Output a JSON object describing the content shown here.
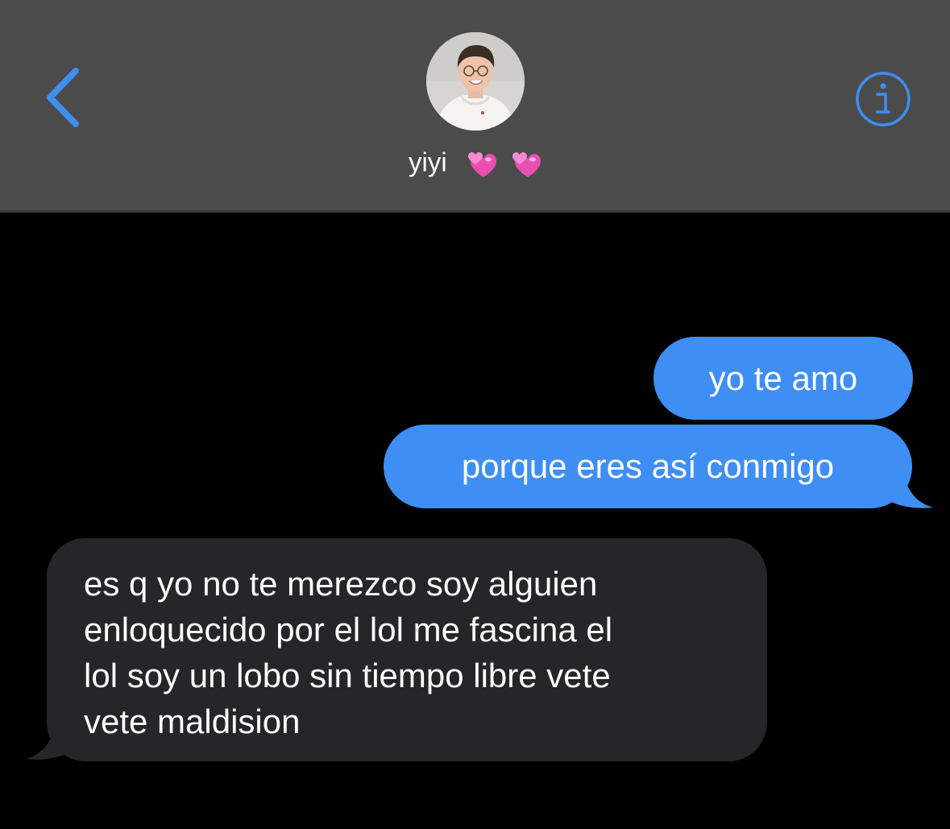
{
  "header": {
    "contact_name": "yiyi",
    "contact_emoji": [
      "revolving-hearts-icon",
      "revolving-hearts-icon"
    ],
    "back_icon": "chevron-left-icon",
    "info_icon": "info-icon",
    "accent_color": "#3e8ef4",
    "background_color": "#4b4b4b"
  },
  "messages": [
    {
      "direction": "outgoing",
      "text": "yo te amo"
    },
    {
      "direction": "outgoing",
      "text": "porque eres así conmigo"
    },
    {
      "direction": "incoming",
      "lines": [
        "es q yo no te merezco soy alguien",
        "enloquecido por el lol me fascina el",
        "lol soy un lobo sin tiempo libre vete",
        "vete maldision"
      ]
    }
  ],
  "colors": {
    "outgoing_bubble": "#3e8ef4",
    "incoming_bubble": "#262628",
    "chat_background": "#000000"
  }
}
